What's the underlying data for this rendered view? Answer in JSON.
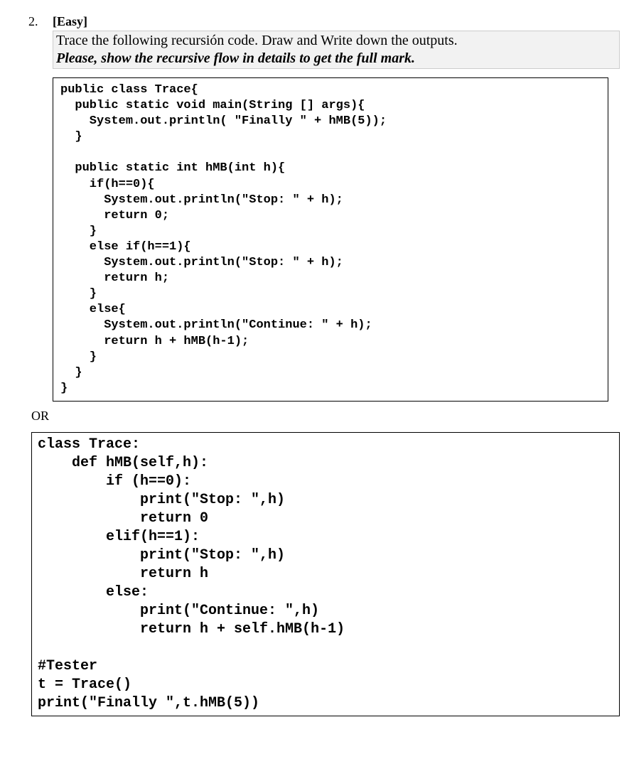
{
  "question": {
    "number": "2.",
    "difficulty": "[Easy]",
    "prompt_line1": "Trace the following recursión code. Draw and Write down the outputs.",
    "prompt_line2": "Please, show the recursive flow in details to get the full mark."
  },
  "or_label": "OR",
  "code_java": "public class Trace{\n  public static void main(String [] args){\n    System.out.println( \"Finally \" + hMB(5));\n  }\n\n  public static int hMB(int h){\n    if(h==0){\n      System.out.println(\"Stop: \" + h);\n      return 0;\n    }\n    else if(h==1){\n      System.out.println(\"Stop: \" + h);\n      return h;\n    }\n    else{\n      System.out.println(\"Continue: \" + h);\n      return h + hMB(h-1);\n    }\n  }\n}",
  "code_python": "class Trace:\n    def hMB(self,h):\n        if (h==0):\n            print(\"Stop: \",h)\n            return 0\n        elif(h==1):\n            print(\"Stop: \",h)\n            return h\n        else:\n            print(\"Continue: \",h)\n            return h + self.hMB(h-1)\n\n#Tester\nt = Trace()\nprint(\"Finally \",t.hMB(5))"
}
